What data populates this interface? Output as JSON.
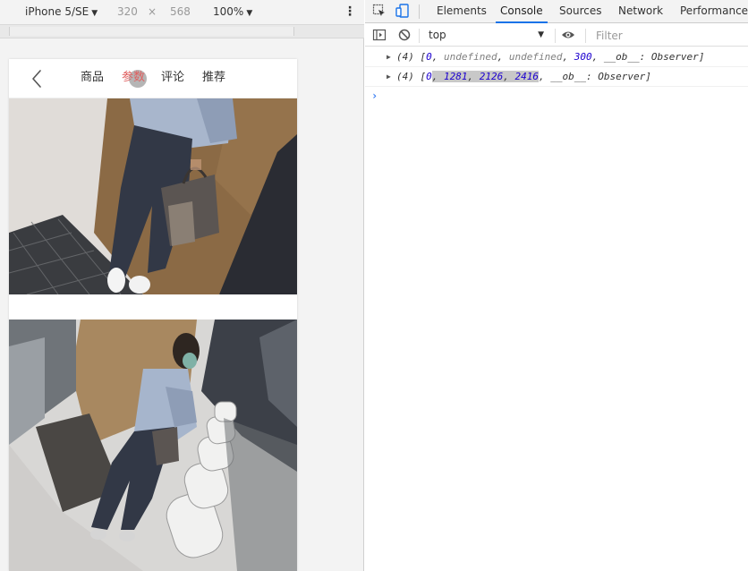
{
  "device_toolbar": {
    "device": "iPhone 5/SE",
    "width": "320",
    "times": "×",
    "height": "568",
    "zoom": "100%",
    "more": "⋮"
  },
  "phone": {
    "tabs": [
      "商品",
      "参数",
      "评论",
      "推荐"
    ],
    "active_tab_index": 1,
    "active_color": "#e06060"
  },
  "devtools": {
    "tabs": [
      "Elements",
      "Console",
      "Sources",
      "Network",
      "Performance"
    ],
    "active_tab": "Console",
    "context": "top",
    "filter_placeholder": "Filter",
    "logs": [
      {
        "count": "(4)",
        "open": "[",
        "items": [
          "0",
          "undefined",
          "undefined",
          "300"
        ],
        "rest": "__ob__: Observer",
        "close": "]"
      },
      {
        "count": "(4)",
        "open": "[",
        "items": [
          "0",
          "1281",
          "2126",
          "2416"
        ],
        "rest": "__ob__: Observer",
        "close": "]"
      }
    ],
    "prompt": "›"
  },
  "colors": {
    "accent": "#1a73e8",
    "number": "#1c00cf",
    "undefined": "#808080"
  }
}
